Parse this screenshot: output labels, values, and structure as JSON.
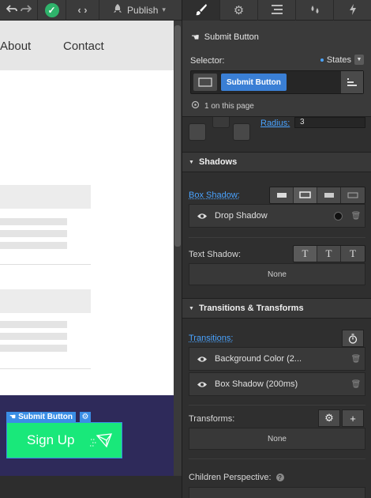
{
  "toolbar": {
    "publish_label": "Publish"
  },
  "canvas": {
    "nav": {
      "links": [
        "About",
        "Contact"
      ]
    },
    "selected_element": {
      "label": "Submit Button"
    },
    "signup_button": {
      "label": "Sign Up"
    }
  },
  "style_panel": {
    "tabs": [
      "style-brush-icon",
      "settings-gear-icon",
      "navigator-icon",
      "swatches-drops-icon",
      "interactions-lightning-icon"
    ],
    "header": {
      "title": "Submit Button"
    },
    "selector": {
      "label": "Selector:",
      "states_label": "States",
      "token": "Submit Button",
      "on_page": "1 on this page"
    },
    "radius": {
      "label": "Radius:",
      "value": "3"
    },
    "shadows": {
      "section_title": "Shadows",
      "box_shadow_label": "Box Shadow:",
      "box_shadow_items": [
        "Drop Shadow"
      ],
      "text_shadow_label": "Text Shadow:",
      "text_shadow_value": "None",
      "text_shadow_options": [
        "T",
        "T",
        "T"
      ]
    },
    "transitions": {
      "section_title": "Transitions & Transforms",
      "transitions_label": "Transitions:",
      "items": [
        "Background Color (2...",
        "Box Shadow (200ms)"
      ],
      "transforms_label": "Transforms:",
      "transforms_value": "None",
      "perspective_label": "Children Perspective:"
    }
  },
  "colors": {
    "accent_blue": "#3a8ee6",
    "signup_green": "#19e87a",
    "footer_purple": "#2e2a5a",
    "panel_bg": "#2f2f2f"
  }
}
